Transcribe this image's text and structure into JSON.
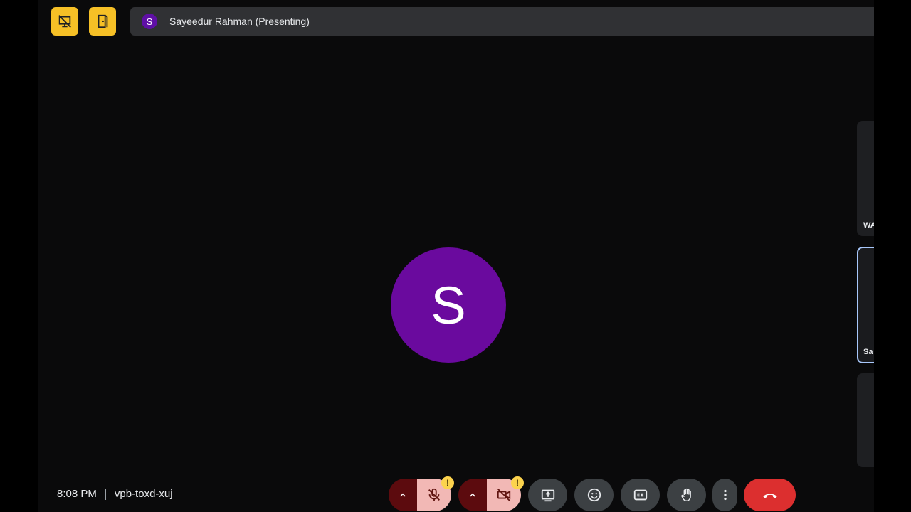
{
  "presenter": {
    "initial": "S",
    "label": "Sayeedur Rahman (Presenting)"
  },
  "main_avatar": {
    "initial": "S"
  },
  "side_tiles": [
    {
      "label": "WA"
    },
    {
      "label": "Sa"
    },
    {
      "label": ""
    }
  ],
  "meeting": {
    "time": "8:08 PM",
    "code": "vpb-toxd-xuj"
  },
  "controls": {
    "mic_warning": "!",
    "camera_warning": "!"
  },
  "icons": {
    "top_left_1": "presentation-off-icon",
    "top_left_2": "door-exit-icon",
    "mic": "mic-off-icon",
    "camera": "videocam-off-icon",
    "present": "present-screen-icon",
    "emoji": "emoji-icon",
    "captions": "closed-captions-icon",
    "hand": "raise-hand-icon",
    "more": "more-vert-icon",
    "hangup": "call-end-icon"
  },
  "colors": {
    "accent_yellow": "#f6c026",
    "avatar_purple": "#6a0a9e",
    "hangup_red": "#dc2f2f",
    "muted_pink": "#f2b8b5",
    "active_tile_border": "#a8c7fa"
  }
}
